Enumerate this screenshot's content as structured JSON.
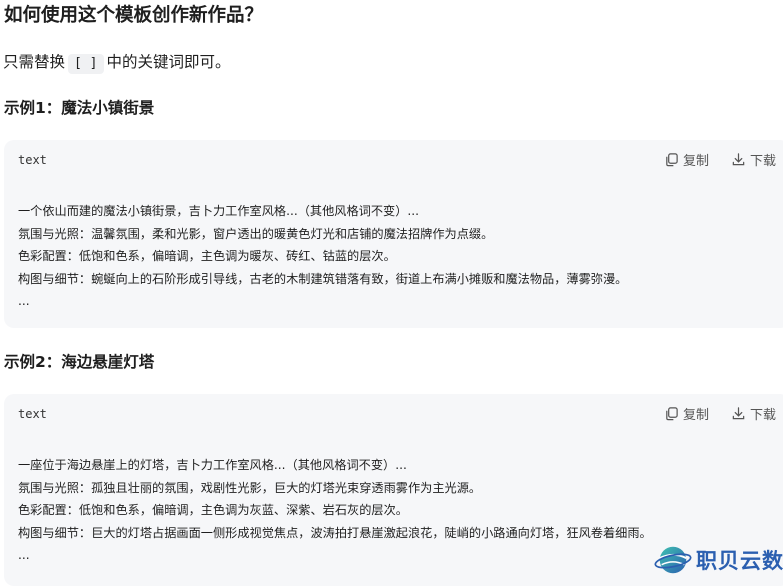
{
  "heading": "如何使用这个模板创作新作品？",
  "intro": {
    "before": "只需替换",
    "code": "[ ]",
    "after": "中的关键词即可。"
  },
  "examples": [
    {
      "title": "示例1：魔法小镇街景",
      "lang": "text",
      "copy_label": "复制",
      "download_label": "下载",
      "lines": [
        "一个依山而建的魔法小镇街景，吉卜力工作室风格...（其他风格词不变）...",
        "氛围与光照：温馨氛围，柔和光影，窗户透出的暖黄色灯光和店铺的魔法招牌作为点缀。",
        "色彩配置：低饱和色系，偏暗调，主色调为暖灰、砖红、钴蓝的层次。",
        "构图与细节：蜿蜒向上的石阶形成引导线，古老的木制建筑错落有致，街道上布满小摊贩和魔法物品，薄雾弥漫。",
        "..."
      ]
    },
    {
      "title": "示例2：海边悬崖灯塔",
      "lang": "text",
      "copy_label": "复制",
      "download_label": "下载",
      "lines": [
        "一座位于海边悬崖上的灯塔，吉卜力工作室风格...（其他风格词不变）...",
        "氛围与光照：孤独且壮丽的氛围，戏剧性光影，巨大的灯塔光束穿透雨雾作为主光源。",
        "色彩配置：低饱和色系，偏暗调，主色调为灰蓝、深紫、岩石灰的层次。",
        "构图与细节：巨大的灯塔占据画面一侧形成视觉焦点，波涛拍打悬崖激起浪花，陡峭的小路通向灯塔，狂风卷着细雨。",
        "..."
      ]
    }
  ],
  "watermark": {
    "text": "职贝云数",
    "icon": "globe-logo-icon",
    "color": "#2b5fb0"
  }
}
